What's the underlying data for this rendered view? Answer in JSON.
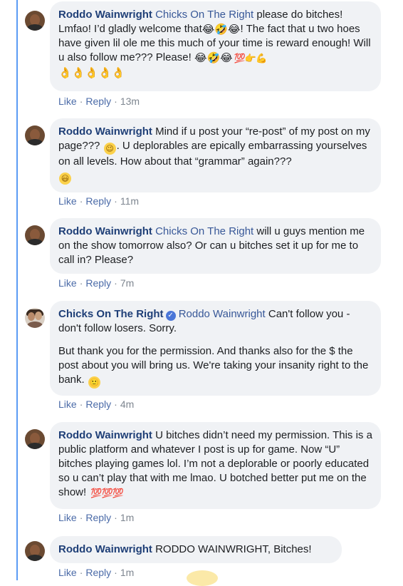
{
  "actions": {
    "like": "Like",
    "reply": "Reply",
    "sep": "·"
  },
  "comments": [
    {
      "author": "Roddo Wainwright",
      "mention": "Chicks On The Right",
      "text_a": " please do bitches! Lmfao! I’d gladly welcome that",
      "text_b": "! The fact that u two hoes have given lil ole me this much of your time is reward enough! Will u also follow me??? Please! ",
      "emoji_a": "😂🤣😂",
      "emoji_b": "😂🤣😂",
      "emoji_c": "💯👉💪",
      "emoji_d": "👌👌👌👌👌",
      "time": "13m"
    },
    {
      "author": "Roddo Wainwright",
      "text_a": " Mind if u post your “re-post” of my post on my page??? ",
      "text_b": ". U deplorables are epically embarrassing yourselves on all levels. How about that “grammar” again??? ",
      "emoji_a": "😉",
      "emoji_b": "😃",
      "time": "11m"
    },
    {
      "author": "Roddo Wainwright",
      "mention": "Chicks On The Right",
      "text_a": " will u guys mention me on the show tomorrow also? Or can u bitches set it up for me to call in? Please?",
      "time": "7m"
    },
    {
      "author": "Chicks On The Right",
      "mention": "Roddo Wainwright",
      "text_a": " Can't follow you - don't follow losers. Sorry.",
      "text_b": "But thank you for the permission. And thanks also for the $ the post about you will bring us. We're taking your insanity right to the bank. ",
      "emoji_a": "🙂",
      "time": "4m"
    },
    {
      "author": "Roddo Wainwright",
      "text_a": " U bitches didn’t need my permission. This is a public platform and whatever I post is up for game. Now “U” bitches playing games lol. I’m not a deplorable or poorly educated so u can’t play that with me lmao. U botched better put me on the show! ",
      "emoji_a": "💯💯💯",
      "time": "1m"
    },
    {
      "author": "Roddo Wainwright",
      "text_a": " RODDO WAINWRIGHT, Bitches!",
      "time": "1m"
    }
  ]
}
